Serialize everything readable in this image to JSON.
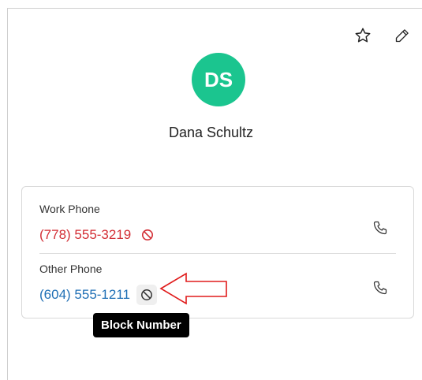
{
  "colors": {
    "avatar_bg": "#1bc58f",
    "blocked_number": "#d32f36",
    "unblocked_number": "#1f6fb5",
    "annotation_arrow": "#e01b1b"
  },
  "header": {
    "favorite_icon": "star-icon",
    "edit_icon": "pencil-icon"
  },
  "contact": {
    "initials": "DS",
    "name": "Dana Schultz"
  },
  "phones": [
    {
      "label": "Work Phone",
      "number": "(778) 555-3219",
      "blocked": true,
      "action_icon": "block-icon",
      "call_icon": "phone-icon"
    },
    {
      "label": "Other Phone",
      "number": "(604) 555-1211",
      "blocked": false,
      "action_icon": "block-icon",
      "call_icon": "phone-icon"
    }
  ],
  "tooltip": {
    "text": "Block Number"
  }
}
